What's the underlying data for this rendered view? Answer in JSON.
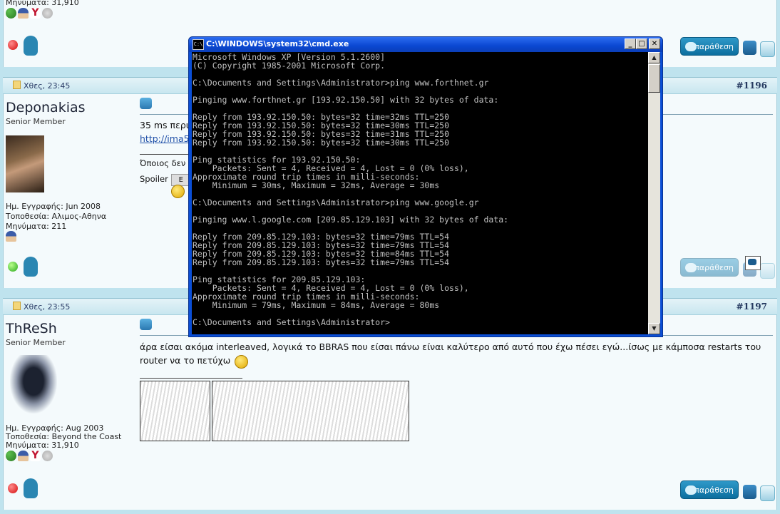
{
  "cmd": {
    "title": "C:\\WINDOWS\\system32\\cmd.exe",
    "icon_label": "C:\\",
    "lines": [
      "Microsoft Windows XP [Version 5.1.2600]",
      "(C) Copyright 1985-2001 Microsoft Corp.",
      "",
      "C:\\Documents and Settings\\Administrator>ping www.forthnet.gr",
      "",
      "Pinging www.forthnet.gr [193.92.150.50] with 32 bytes of data:",
      "",
      "Reply from 193.92.150.50: bytes=32 time=32ms TTL=250",
      "Reply from 193.92.150.50: bytes=32 time=30ms TTL=250",
      "Reply from 193.92.150.50: bytes=32 time=31ms TTL=250",
      "Reply from 193.92.150.50: bytes=32 time=30ms TTL=250",
      "",
      "Ping statistics for 193.92.150.50:",
      "    Packets: Sent = 4, Received = 4, Lost = 0 (0% loss),",
      "Approximate round trip times in milli-seconds:",
      "    Minimum = 30ms, Maximum = 32ms, Average = 30ms",
      "",
      "C:\\Documents and Settings\\Administrator>ping www.google.gr",
      "",
      "Pinging www.l.google.com [209.85.129.103] with 32 bytes of data:",
      "",
      "Reply from 209.85.129.103: bytes=32 time=79ms TTL=54",
      "Reply from 209.85.129.103: bytes=32 time=79ms TTL=54",
      "Reply from 209.85.129.103: bytes=32 time=84ms TTL=54",
      "Reply from 209.85.129.103: bytes=32 time=79ms TTL=54",
      "",
      "Ping statistics for 209.85.129.103:",
      "    Packets: Sent = 4, Received = 4, Lost = 0 (0% loss),",
      "Approximate round trip times in milli-seconds:",
      "    Minimum = 79ms, Maximum = 84ms, Average = 80ms",
      "",
      "C:\\Documents and Settings\\Administrator>"
    ]
  },
  "top_partial": {
    "posts_label": "Μηνύματα: 31,910"
  },
  "quote_label": "παράθεση",
  "posts": [
    {
      "date": "Χθες, 23:45",
      "number": "#1196",
      "username": "Deponakias",
      "rank": "Senior Member",
      "joined": "Ημ. Εγγραφής: Jun 2008",
      "location": "Τοποθεσία: Αλιμος-Αθηνα",
      "posts": "Μηνύματα: 211",
      "msg_line1": "35 ms περι",
      "msg_link": "http://ima5",
      "sig_text": "Όποιος δεν",
      "spoiler": "Spoiler",
      "spoiler_btn": "E"
    },
    {
      "date": "Χθες, 23:55",
      "number": "#1197",
      "username": "ThReSh",
      "rank": "Senior Member",
      "joined": "Ημ. Εγγραφής: Aug 2003",
      "location": "Τοποθεσία: Beyond the Coast",
      "posts": "Μηνύματα: 31,910",
      "msg_line1": "άρα είσαι ακόμα interleaved, λογικά το BBRAS που είσαι πάνω είναι καλύτερο από αυτό που έχω πέσει εγώ...ίσως με κάμποσα restarts του",
      "msg_line2": "router να το πετύχω"
    }
  ]
}
